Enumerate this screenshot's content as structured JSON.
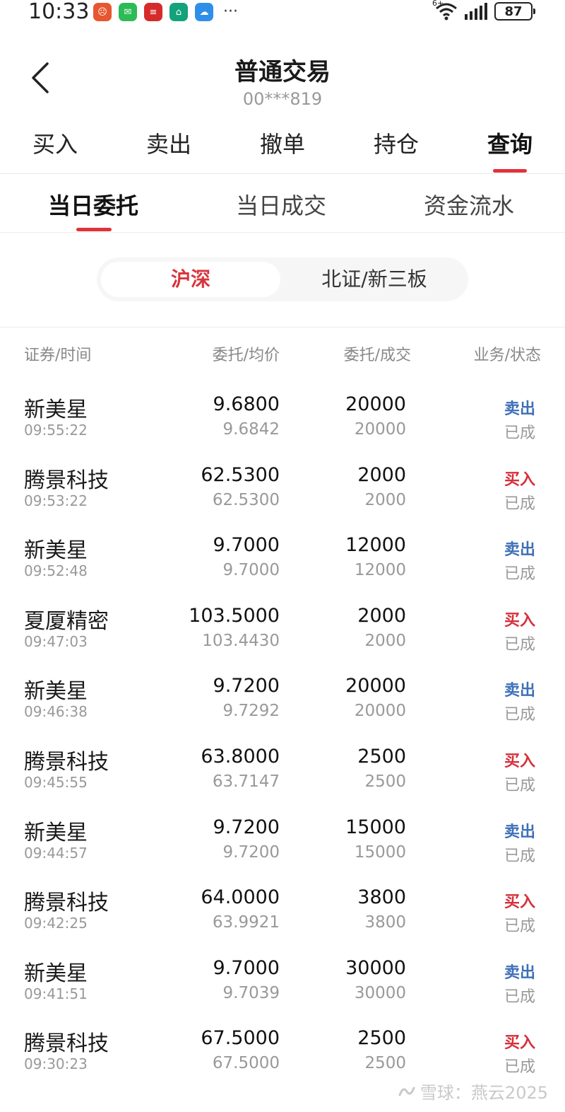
{
  "status_bar": {
    "time": "10:33",
    "more": "···",
    "network_label": "6+",
    "battery": "87"
  },
  "header": {
    "title": "普通交易",
    "account": "00***819"
  },
  "main_tabs": [
    "买入",
    "卖出",
    "撤单",
    "持仓",
    "查询"
  ],
  "sub_tabs": [
    "当日委托",
    "当日成交",
    "资金流水"
  ],
  "market_segment": [
    "沪深",
    "北证/新三板"
  ],
  "table_headers": [
    "证券/时间",
    "委托/均价",
    "委托/成交",
    "业务/状态"
  ],
  "orders": [
    {
      "name": "新美星",
      "time": "09:55:22",
      "price": "9.6800",
      "avg": "9.6842",
      "qty": "20000",
      "filled": "20000",
      "side": "卖出",
      "status": "已成"
    },
    {
      "name": "腾景科技",
      "time": "09:53:22",
      "price": "62.5300",
      "avg": "62.5300",
      "qty": "2000",
      "filled": "2000",
      "side": "买入",
      "status": "已成"
    },
    {
      "name": "新美星",
      "time": "09:52:48",
      "price": "9.7000",
      "avg": "9.7000",
      "qty": "12000",
      "filled": "12000",
      "side": "卖出",
      "status": "已成"
    },
    {
      "name": "夏厦精密",
      "time": "09:47:03",
      "price": "103.5000",
      "avg": "103.4430",
      "qty": "2000",
      "filled": "2000",
      "side": "买入",
      "status": "已成"
    },
    {
      "name": "新美星",
      "time": "09:46:38",
      "price": "9.7200",
      "avg": "9.7292",
      "qty": "20000",
      "filled": "20000",
      "side": "卖出",
      "status": "已成"
    },
    {
      "name": "腾景科技",
      "time": "09:45:55",
      "price": "63.8000",
      "avg": "63.7147",
      "qty": "2500",
      "filled": "2500",
      "side": "买入",
      "status": "已成"
    },
    {
      "name": "新美星",
      "time": "09:44:57",
      "price": "9.7200",
      "avg": "9.7200",
      "qty": "15000",
      "filled": "15000",
      "side": "卖出",
      "status": "已成"
    },
    {
      "name": "腾景科技",
      "time": "09:42:25",
      "price": "64.0000",
      "avg": "63.9921",
      "qty": "3800",
      "filled": "3800",
      "side": "买入",
      "status": "已成"
    },
    {
      "name": "新美星",
      "time": "09:41:51",
      "price": "9.7000",
      "avg": "9.7039",
      "qty": "30000",
      "filled": "30000",
      "side": "卖出",
      "status": "已成"
    },
    {
      "name": "腾景科技",
      "time": "09:30:23",
      "price": "67.5000",
      "avg": "67.5000",
      "qty": "2500",
      "filled": "2500",
      "side": "买入",
      "status": "已成"
    }
  ],
  "colors": {
    "accent": "#e0323a",
    "sell": "#3e6fb8",
    "buy": "#d62f3a"
  },
  "watermark": "雪球：燕云2025"
}
